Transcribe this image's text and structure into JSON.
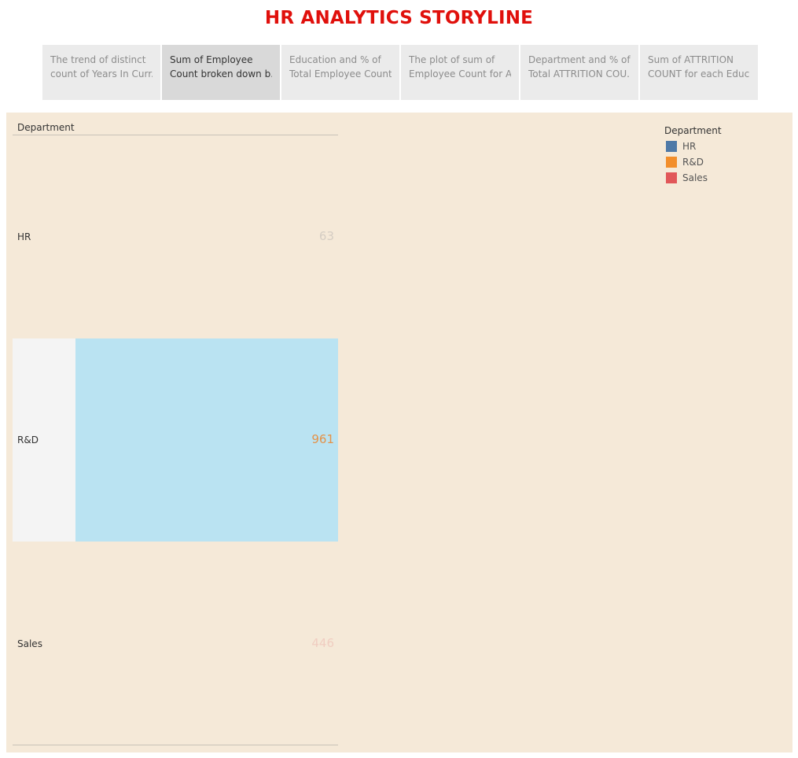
{
  "story": {
    "title": "HR ANALYTICS STORYLINE"
  },
  "nav": {
    "tabs": [
      {
        "line1": "The trend of distinct",
        "line2": "count of Years In Curr..",
        "active": false
      },
      {
        "line1": "Sum of Employee",
        "line2": "Count broken down b..",
        "active": true
      },
      {
        "line1": "Education and % of",
        "line2": "Total Employee Count..",
        "active": false
      },
      {
        "line1": "The plot of sum of",
        "line2": "Employee Count for A..",
        "active": false
      },
      {
        "line1": "Department and % of",
        "line2": "Total ATTRITION COU..",
        "active": false
      },
      {
        "line1": "Sum of ATTRITION",
        "line2": "COUNT for each Educ..",
        "active": false
      }
    ]
  },
  "colors": {
    "title": "#e0100c",
    "dashboard_background": "#f5e9d8",
    "selection_fill": "#bae3f2",
    "HR": "#4e79a7",
    "R&D": "#f28e2b",
    "Sales": "#e15759"
  },
  "table": {
    "row_header": "Department",
    "rows": [
      {
        "label": "HR",
        "value": "63",
        "value_color": "#d5cdc3",
        "selected": false
      },
      {
        "label": "R&D",
        "value": "961",
        "value_color": "#e49248",
        "selected": true
      },
      {
        "label": "Sales",
        "value": "446",
        "value_color": "#f0cdc1",
        "selected": false
      }
    ]
  },
  "legend": {
    "title": "Department",
    "items": [
      {
        "label": "HR",
        "color": "#4e79a7"
      },
      {
        "label": "R&D",
        "color": "#f28e2b"
      },
      {
        "label": "Sales",
        "color": "#e15759"
      }
    ]
  }
}
